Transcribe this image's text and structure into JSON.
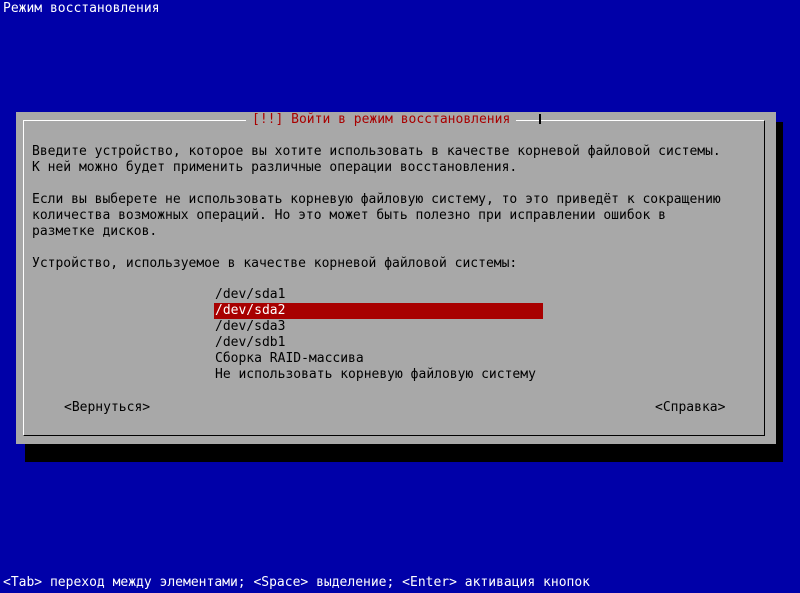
{
  "screen_title": "Режим восстановления",
  "dialog": {
    "title": "[!!] Войти в режим восстановления",
    "paragraph1": "Введите устройство, которое вы хотите использовать в качестве корневой файловой системы.\nК ней можно будет применить различные операции восстановления.",
    "paragraph2": "Если вы выберете не использовать корневую файловую систему, то это приведёт к сокращению\nколичества возможных операций. Но это может быть полезно при исправлении ошибок в\nразметке дисков.",
    "prompt": "Устройство, используемое в качестве корневой файловой системы:",
    "options": [
      {
        "label": "/dev/sda1",
        "selected": false
      },
      {
        "label": "/dev/sda2",
        "selected": true
      },
      {
        "label": "/dev/sda3",
        "selected": false
      },
      {
        "label": "/dev/sdb1",
        "selected": false
      },
      {
        "label": "Сборка RAID-массива",
        "selected": false
      },
      {
        "label": "Не использовать корневую файловую систему",
        "selected": false
      }
    ],
    "back_button": "<Вернуться>",
    "help_button": "<Справка>"
  },
  "status_bar": "<Tab> переход между элементами; <Space> выделение; <Enter> активация кнопок",
  "colors": {
    "background": "#0000a8",
    "dialog": "#a8a8a8",
    "accent": "#a80000"
  }
}
